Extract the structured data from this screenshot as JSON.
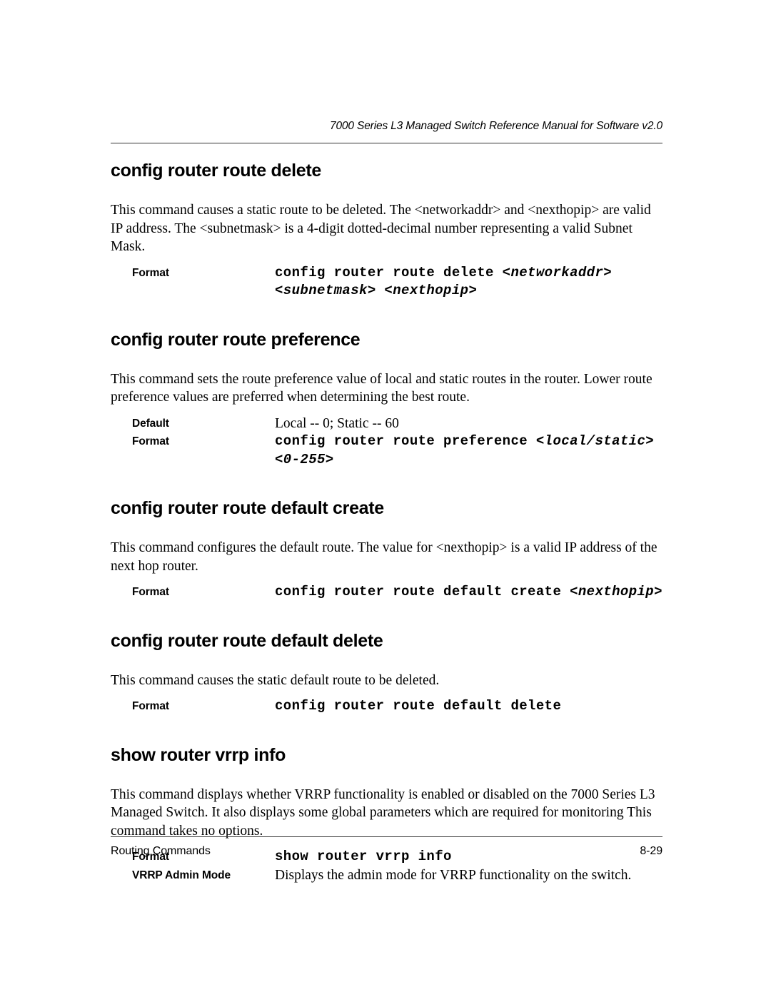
{
  "header": {
    "running_title": "7000 Series L3 Managed Switch Reference Manual for Software v2.0"
  },
  "footer": {
    "section_name": "Routing Commands",
    "page_number": "8-29"
  },
  "labels": {
    "format": "Format",
    "default": "Default",
    "vrrp_admin_mode": "VRRP Admin Mode"
  },
  "sections": [
    {
      "heading": "config router route delete",
      "description": "This command causes a static route to be deleted.   The <networkaddr> and <nexthopip> are valid IP address. The <subnetmask> is a 4-digit dotted-decimal number representing a valid Subnet Mask.",
      "format_command": "config router route delete ",
      "format_params": "<networkaddr> <subnetmask> <nexthopip>"
    },
    {
      "heading": "config router route preference",
      "description": "This command sets the route preference value of local and static routes in the router. Lower route preference values are preferred when determining the best route.",
      "default_value": "Local -- 0; Static -- 60",
      "format_command": "config router route preference ",
      "format_params": "<local/static> <0-255>"
    },
    {
      "heading": "config router route default create",
      "description": "This command configures the default route. The value for <nexthopip> is a valid IP address of the next hop router.",
      "format_command": "config router route default create ",
      "format_params": "<nexthopip>"
    },
    {
      "heading": "config router route default delete",
      "description": "This command causes the static default route to be deleted.",
      "format_command": "config router route default delete",
      "format_params": ""
    },
    {
      "heading": "show router vrrp info",
      "description": "This command displays whether VRRP functionality is enabled or disabled on the 7000 Series L3 Managed Switch. It also displays some global parameters which are required for monitoring   This command takes no options.",
      "format_command": "show router vrrp info",
      "format_params": "",
      "vrrp_admin_mode_desc": "Displays the admin mode for VRRP functionality on the switch."
    }
  ]
}
